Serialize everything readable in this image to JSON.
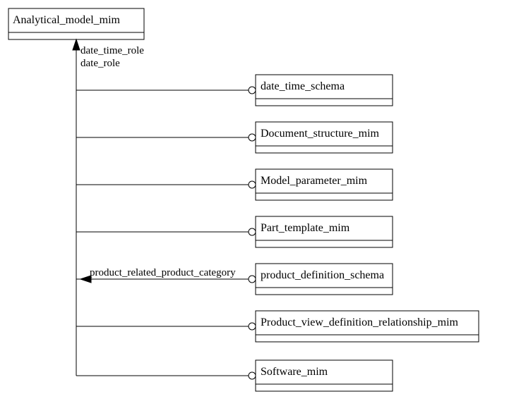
{
  "root": {
    "title": "Analytical_model_mim"
  },
  "targets": [
    {
      "label": "date_time_schema"
    },
    {
      "label": "Document_structure_mim"
    },
    {
      "label": "Model_parameter_mim"
    },
    {
      "label": "Part_template_mim"
    },
    {
      "label": "product_definition_schema"
    },
    {
      "label": "Product_view_definition_relationship_mim"
    },
    {
      "label": "Software_mim"
    }
  ],
  "edge_labels": {
    "date_time_role": "date_time_role",
    "date_role": "date_role",
    "product_related_product_category": "product_related_product_category"
  }
}
